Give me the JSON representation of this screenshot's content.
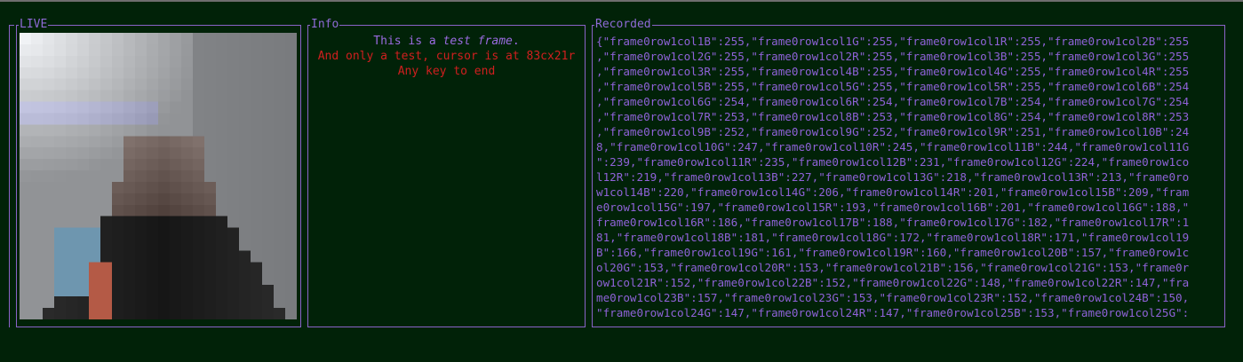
{
  "panels": {
    "live_title": "LIVE",
    "info_title": "Info",
    "recorded_title": "Recorded"
  },
  "info": {
    "line1_prefix": "This is a ",
    "line1_em": "test frame",
    "line1_suffix": ".",
    "line2": "And only a test, cursor is at 83cx21r",
    "line3": "Any key to end"
  },
  "recorded": {
    "lines": [
      "{\"frame0row1col1B\":255,\"frame0row1col1G\":255,\"frame0row1col1R\":255,\"frame0row1col2B\":255",
      ",\"frame0row1col2G\":255,\"frame0row1col2R\":255,\"frame0row1col3B\":255,\"frame0row1col3G\":255",
      ",\"frame0row1col3R\":255,\"frame0row1col4B\":255,\"frame0row1col4G\":255,\"frame0row1col4R\":255",
      ",\"frame0row1col5B\":255,\"frame0row1col5G\":255,\"frame0row1col5R\":255,\"frame0row1col6B\":254",
      ",\"frame0row1col6G\":254,\"frame0row1col6R\":254,\"frame0row1col7B\":254,\"frame0row1col7G\":254",
      ",\"frame0row1col7R\":253,\"frame0row1col8B\":253,\"frame0row1col8G\":254,\"frame0row1col8R\":253",
      ",\"frame0row1col9B\":252,\"frame0row1col9G\":252,\"frame0row1col9R\":251,\"frame0row1col10B\":24",
      "8,\"frame0row1col10G\":247,\"frame0row1col10R\":245,\"frame0row1col11B\":244,\"frame0row1col11G",
      "\":239,\"frame0row1col11R\":235,\"frame0row1col12B\":231,\"frame0row1col12G\":224,\"frame0row1co",
      "l12R\":219,\"frame0row1col13B\":227,\"frame0row1col13G\":218,\"frame0row1col13R\":213,\"frame0ro",
      "w1col14B\":220,\"frame0row1col14G\":206,\"frame0row1col14R\":201,\"frame0row1col15B\":209,\"fram",
      "e0row1col15G\":197,\"frame0row1col15R\":193,\"frame0row1col16B\":201,\"frame0row1col16G\":188,\"",
      "frame0row1col16R\":186,\"frame0row1col17B\":188,\"frame0row1col17G\":182,\"frame0row1col17R\":1",
      "81,\"frame0row1col18B\":181,\"frame0row1col18G\":172,\"frame0row1col18R\":171,\"frame0row1col19",
      "B\":166,\"frame0row1col19G\":161,\"frame0row1col19R\":160,\"frame0row1col20B\":157,\"frame0row1c",
      "ol20G\":153,\"frame0row1col20R\":153,\"frame0row1col21B\":156,\"frame0row1col21G\":153,\"frame0r",
      "ow1col21R\":152,\"frame0row1col22B\":152,\"frame0row1col22G\":148,\"frame0row1col22R\":147,\"fra",
      "me0row1col23B\":157,\"frame0row1col23G\":153,\"frame0row1col23R\":152,\"frame0row1col24B\":150,",
      "\"frame0row1col24G\":147,\"frame0row1col24R\":147,\"frame0row1col25B\":153,\"frame0row1col25G\":"
    ]
  },
  "colors": {
    "background": "#012208",
    "border": "#8a63c8",
    "text_purple": "#8f62d8",
    "text_red": "#d11f1f"
  }
}
